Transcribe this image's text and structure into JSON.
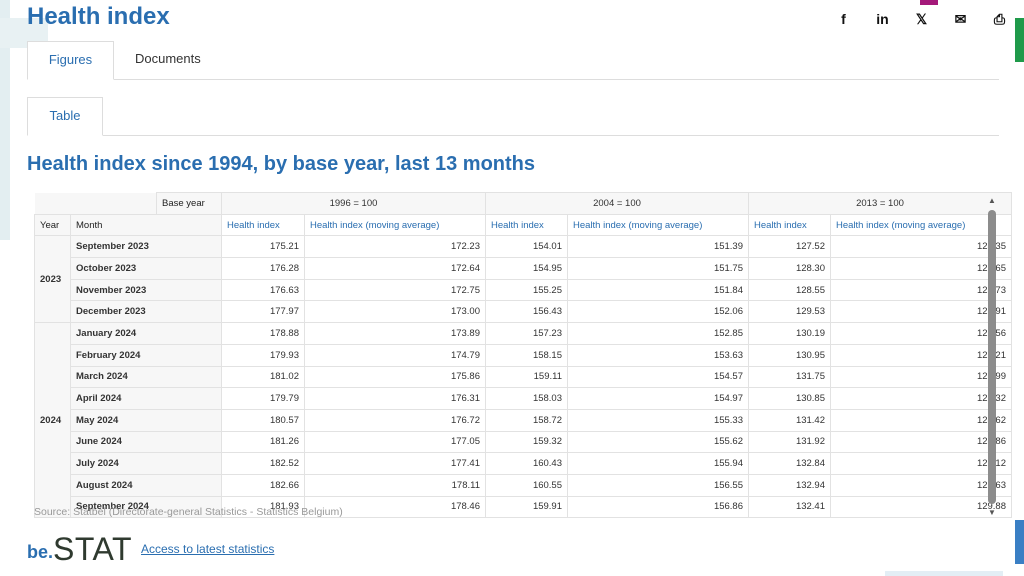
{
  "page": {
    "title": "Health index"
  },
  "share_icons": [
    {
      "name": "facebook-icon",
      "glyph": "f"
    },
    {
      "name": "linkedin-icon",
      "glyph": "in"
    },
    {
      "name": "x-icon",
      "glyph": "𝕏"
    },
    {
      "name": "mail-icon",
      "glyph": "✉"
    },
    {
      "name": "print-icon",
      "glyph": "⎙"
    }
  ],
  "tabs": [
    "Figures",
    "Documents"
  ],
  "subtabs": [
    "Table"
  ],
  "section_title": "Health index since 1994, by base year, last 13 months",
  "table": {
    "base_year_label": "Base year",
    "year_label": "Year",
    "month_label": "Month",
    "base_groups": [
      "1996 = 100",
      "2004 = 100",
      "2013 = 100"
    ],
    "col_health_index": "Health index",
    "col_moving_avg": "Health index (moving average)",
    "year_groups": [
      {
        "year": "2023",
        "rows": [
          {
            "month": "September 2023",
            "values": [
              "175.21",
              "172.23",
              "154.01",
              "151.39",
              "127.52",
              "125.35"
            ]
          },
          {
            "month": "October 2023",
            "values": [
              "176.28",
              "172.64",
              "154.95",
              "151.75",
              "128.30",
              "125.65"
            ]
          },
          {
            "month": "November 2023",
            "values": [
              "176.63",
              "172.75",
              "155.25",
              "151.84",
              "128.55",
              "125.73"
            ]
          },
          {
            "month": "December 2023",
            "values": [
              "177.97",
              "173.00",
              "156.43",
              "152.06",
              "129.53",
              "125.91"
            ]
          }
        ]
      },
      {
        "year": "2024",
        "rows": [
          {
            "month": "January 2024",
            "values": [
              "178.88",
              "173.89",
              "157.23",
              "152.85",
              "130.19",
              "126.56"
            ]
          },
          {
            "month": "February 2024",
            "values": [
              "179.93",
              "174.79",
              "158.15",
              "153.63",
              "130.95",
              "127.21"
            ]
          },
          {
            "month": "March 2024",
            "values": [
              "181.02",
              "175.86",
              "159.11",
              "154.57",
              "131.75",
              "127.99"
            ]
          },
          {
            "month": "April 2024",
            "values": [
              "179.79",
              "176.31",
              "158.03",
              "154.97",
              "130.85",
              "128.32"
            ]
          },
          {
            "month": "May 2024",
            "values": [
              "180.57",
              "176.72",
              "158.72",
              "155.33",
              "131.42",
              "128.62"
            ]
          },
          {
            "month": "June 2024",
            "values": [
              "181.26",
              "177.05",
              "159.32",
              "155.62",
              "131.92",
              "128.86"
            ]
          },
          {
            "month": "July 2024",
            "values": [
              "182.52",
              "177.41",
              "160.43",
              "155.94",
              "132.84",
              "129.12"
            ]
          },
          {
            "month": "August 2024",
            "values": [
              "182.66",
              "178.11",
              "160.55",
              "156.55",
              "132.94",
              "129.63"
            ]
          },
          {
            "month": "September 2024",
            "values": [
              "181.93",
              "178.46",
              "159.91",
              "156.86",
              "132.41",
              "129.88"
            ]
          }
        ]
      }
    ]
  },
  "source": "Source: Statbel (Directorate-general Statistics - Statistics Belgium)",
  "logo": {
    "prefix": "be.",
    "name": "STAT"
  },
  "access_link": "Access to latest statistics",
  "colors": {
    "brand_blue": "#2a6eb0",
    "accent_green": "#1f9a4a",
    "accent_purple": "#a4197a"
  }
}
